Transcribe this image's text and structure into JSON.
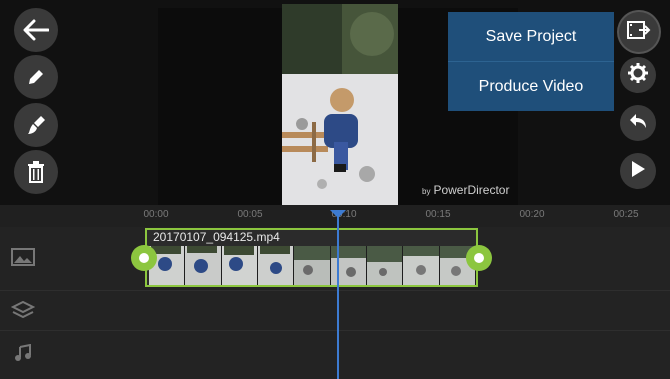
{
  "menu": {
    "items": [
      {
        "label": "Save Project"
      },
      {
        "label": "Produce Video"
      }
    ]
  },
  "left_toolbar": {
    "icons": [
      "back-arrow-icon",
      "pencil-icon",
      "brush-icon",
      "trash-icon"
    ]
  },
  "right_toolbar": {
    "icons": [
      "film-export-icon",
      "gear-icon",
      "undo-icon",
      "play-icon"
    ]
  },
  "preview": {
    "watermark_prefix": "by",
    "watermark": "PowerDirector"
  },
  "timeline": {
    "ticks": [
      "00:00",
      "00:05",
      "00:10",
      "00:15",
      "00:20",
      "00:25"
    ],
    "clip": {
      "filename": "20170107_094125.mp4"
    },
    "track_icons": [
      "image-track-icon",
      "layers-icon",
      "music-icon"
    ]
  },
  "colors": {
    "accent_green": "#8cc63f",
    "menu_blue": "#1f4f7a",
    "playhead_blue": "#3d7bd1"
  }
}
